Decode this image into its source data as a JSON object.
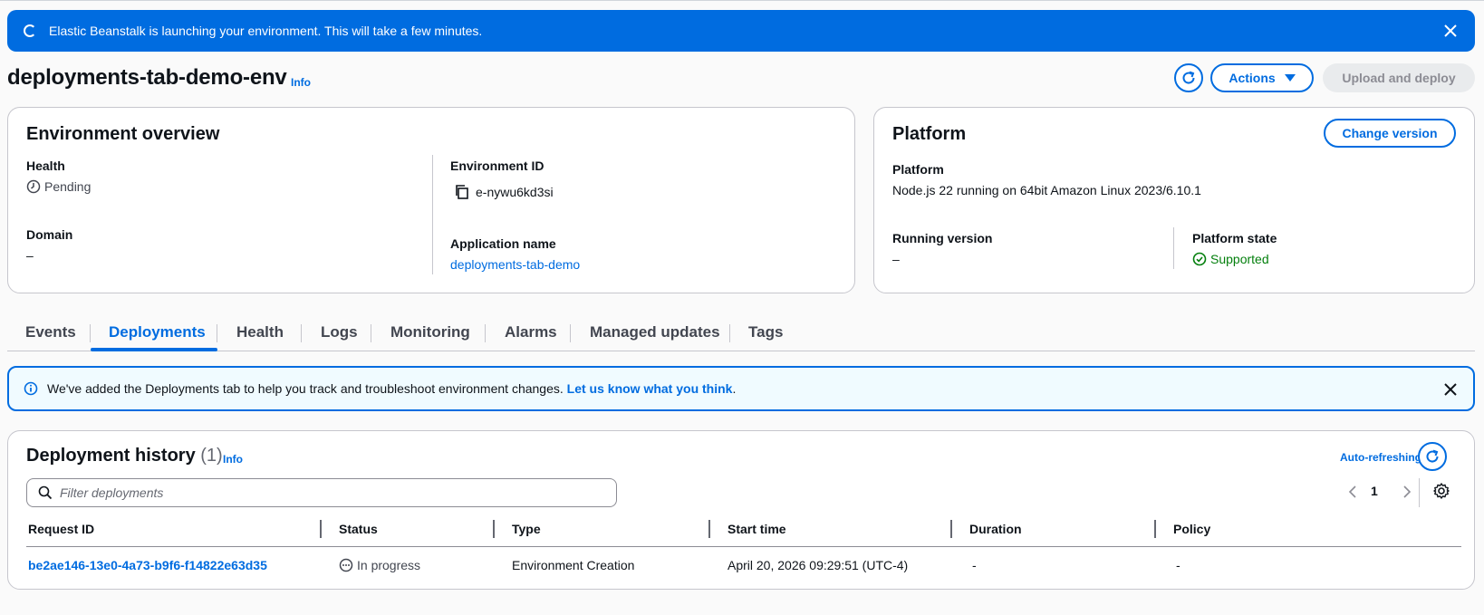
{
  "flash": {
    "message": "Elastic Beanstalk is launching your environment. This will take a few minutes."
  },
  "header": {
    "title": "deployments-tab-demo-env",
    "info": "Info",
    "actions_label": "Actions",
    "upload_label": "Upload and deploy"
  },
  "overview": {
    "title": "Environment overview",
    "health_label": "Health",
    "health_value": "Pending",
    "domain_label": "Domain",
    "domain_value": "–",
    "env_id_label": "Environment ID",
    "env_id_value": "e-nywu6kd3si",
    "app_name_label": "Application name",
    "app_name_value": "deployments-tab-demo"
  },
  "platform": {
    "title": "Platform",
    "change_version_label": "Change version",
    "platform_label": "Platform",
    "platform_value": "Node.js 22 running on 64bit Amazon Linux 2023/6.10.1",
    "running_version_label": "Running version",
    "running_version_value": "–",
    "state_label": "Platform state",
    "state_value": "Supported"
  },
  "tabs": [
    {
      "label": "Events"
    },
    {
      "label": "Deployments"
    },
    {
      "label": "Health"
    },
    {
      "label": "Logs"
    },
    {
      "label": "Monitoring"
    },
    {
      "label": "Alarms"
    },
    {
      "label": "Managed updates"
    },
    {
      "label": "Tags"
    }
  ],
  "alert": {
    "message": "We've added the Deployments tab to help you track and troubleshoot environment changes.",
    "link": "Let us know what you think",
    "suffix": "."
  },
  "history": {
    "title": "Deployment history",
    "count": "(1)",
    "info": "Info",
    "auto_refresh": "Auto-refreshing",
    "filter_placeholder": "Filter deployments",
    "page": "1",
    "columns": [
      "Request ID",
      "Status",
      "Type",
      "Start time",
      "Duration",
      "Policy"
    ],
    "rows": [
      {
        "request_id": "be2ae146-13e0-4a73-b9f6-f14822e63d35",
        "status": "In progress",
        "type": "Environment Creation",
        "start_time": "April 20, 2026 09:29:51 (UTC-4)",
        "duration": "-",
        "policy": "-"
      }
    ]
  },
  "colors": {
    "accent": "#006ce0",
    "success": "#037f0c",
    "flash_bg": "#006ce0",
    "info_bg": "#f0fbff"
  },
  "icons": [
    "spinner-icon",
    "close-icon",
    "refresh-icon",
    "caret-down-icon",
    "clock-icon",
    "copy-icon",
    "check-circle-icon",
    "info-icon",
    "search-icon",
    "chevron-left-icon",
    "chevron-right-icon",
    "gear-icon",
    "status-in-progress-icon"
  ]
}
